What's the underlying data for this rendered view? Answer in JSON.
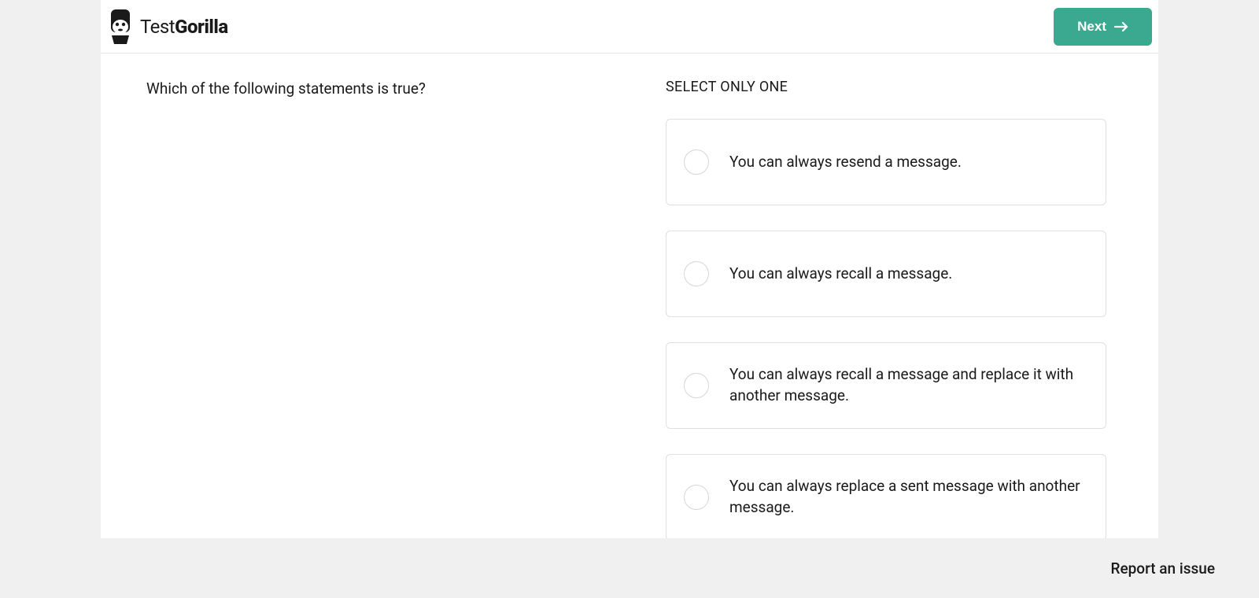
{
  "header": {
    "logo_text_light": "Test",
    "logo_text_bold": "Gorilla",
    "next_button_label": "Next"
  },
  "question": {
    "prompt": "Which of the following statements is true?",
    "select_instruction": "SELECT ONLY ONE",
    "options": [
      "You can always resend a message.",
      "You can always recall a message.",
      "You can always recall a message and replace it with another message.",
      "You can always replace a sent message with another message."
    ]
  },
  "footer": {
    "report_link": "Report an issue"
  }
}
